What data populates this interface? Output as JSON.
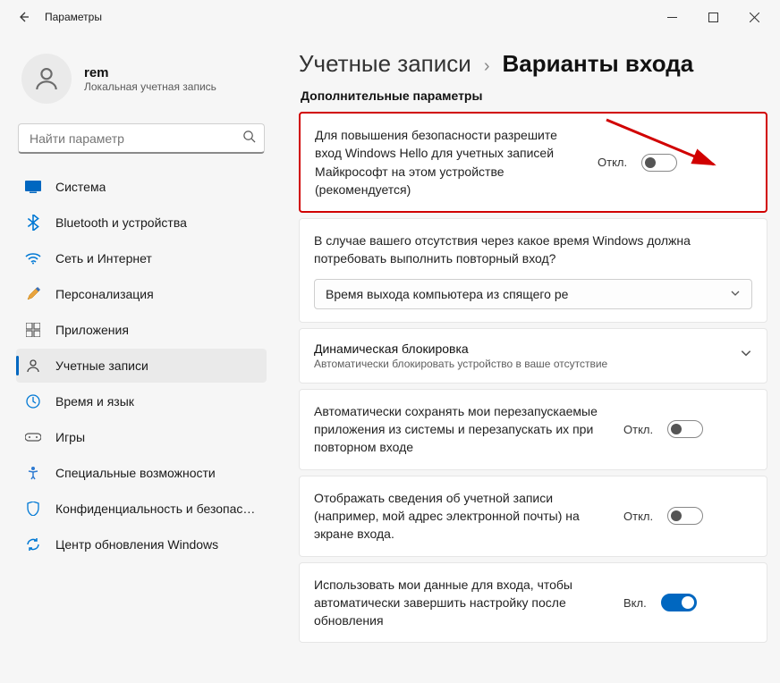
{
  "window": {
    "title": "Параметры"
  },
  "user": {
    "name": "rem",
    "subtitle": "Локальная учетная запись"
  },
  "search": {
    "placeholder": "Найти параметр"
  },
  "nav": {
    "system": "Система",
    "bluetooth": "Bluetooth и устройства",
    "network": "Сеть и Интернет",
    "personalization": "Персонализация",
    "apps": "Приложения",
    "accounts": "Учетные записи",
    "time_lang": "Время и язык",
    "games": "Игры",
    "accessibility": "Специальные возможности",
    "privacy": "Конфиденциальность и безопасность",
    "update": "Центр обновления Windows"
  },
  "breadcrumb": {
    "parent": "Учетные записи",
    "current": "Варианты входа"
  },
  "section_heading": "Дополнительные параметры",
  "cards": {
    "hello": {
      "text": "Для повышения безопасности разрешите вход Windows Hello для учетных записей Майкрософт на этом устройстве (рекомендуется)",
      "state_label": "Откл."
    },
    "away": {
      "text": "В случае вашего отсутствия через какое время Windows должна потребовать выполнить повторный вход?",
      "dropdown_value": "Время выхода компьютера из спящего ре"
    },
    "dynlock": {
      "title": "Динамическая блокировка",
      "subtitle": "Автоматически блокировать устройство в ваше отсутствие"
    },
    "restart_apps": {
      "text": "Автоматически сохранять мои перезапускаемые приложения из системы и перезапускать их при повторном входе",
      "state_label": "Откл."
    },
    "show_account": {
      "text": "Отображать сведения об учетной записи (например, мой адрес электронной почты) на экране входа.",
      "state_label": "Откл."
    },
    "use_signin": {
      "text": "Использовать мои данные для входа, чтобы автоматически завершить настройку после обновления",
      "state_label": "Вкл."
    }
  }
}
